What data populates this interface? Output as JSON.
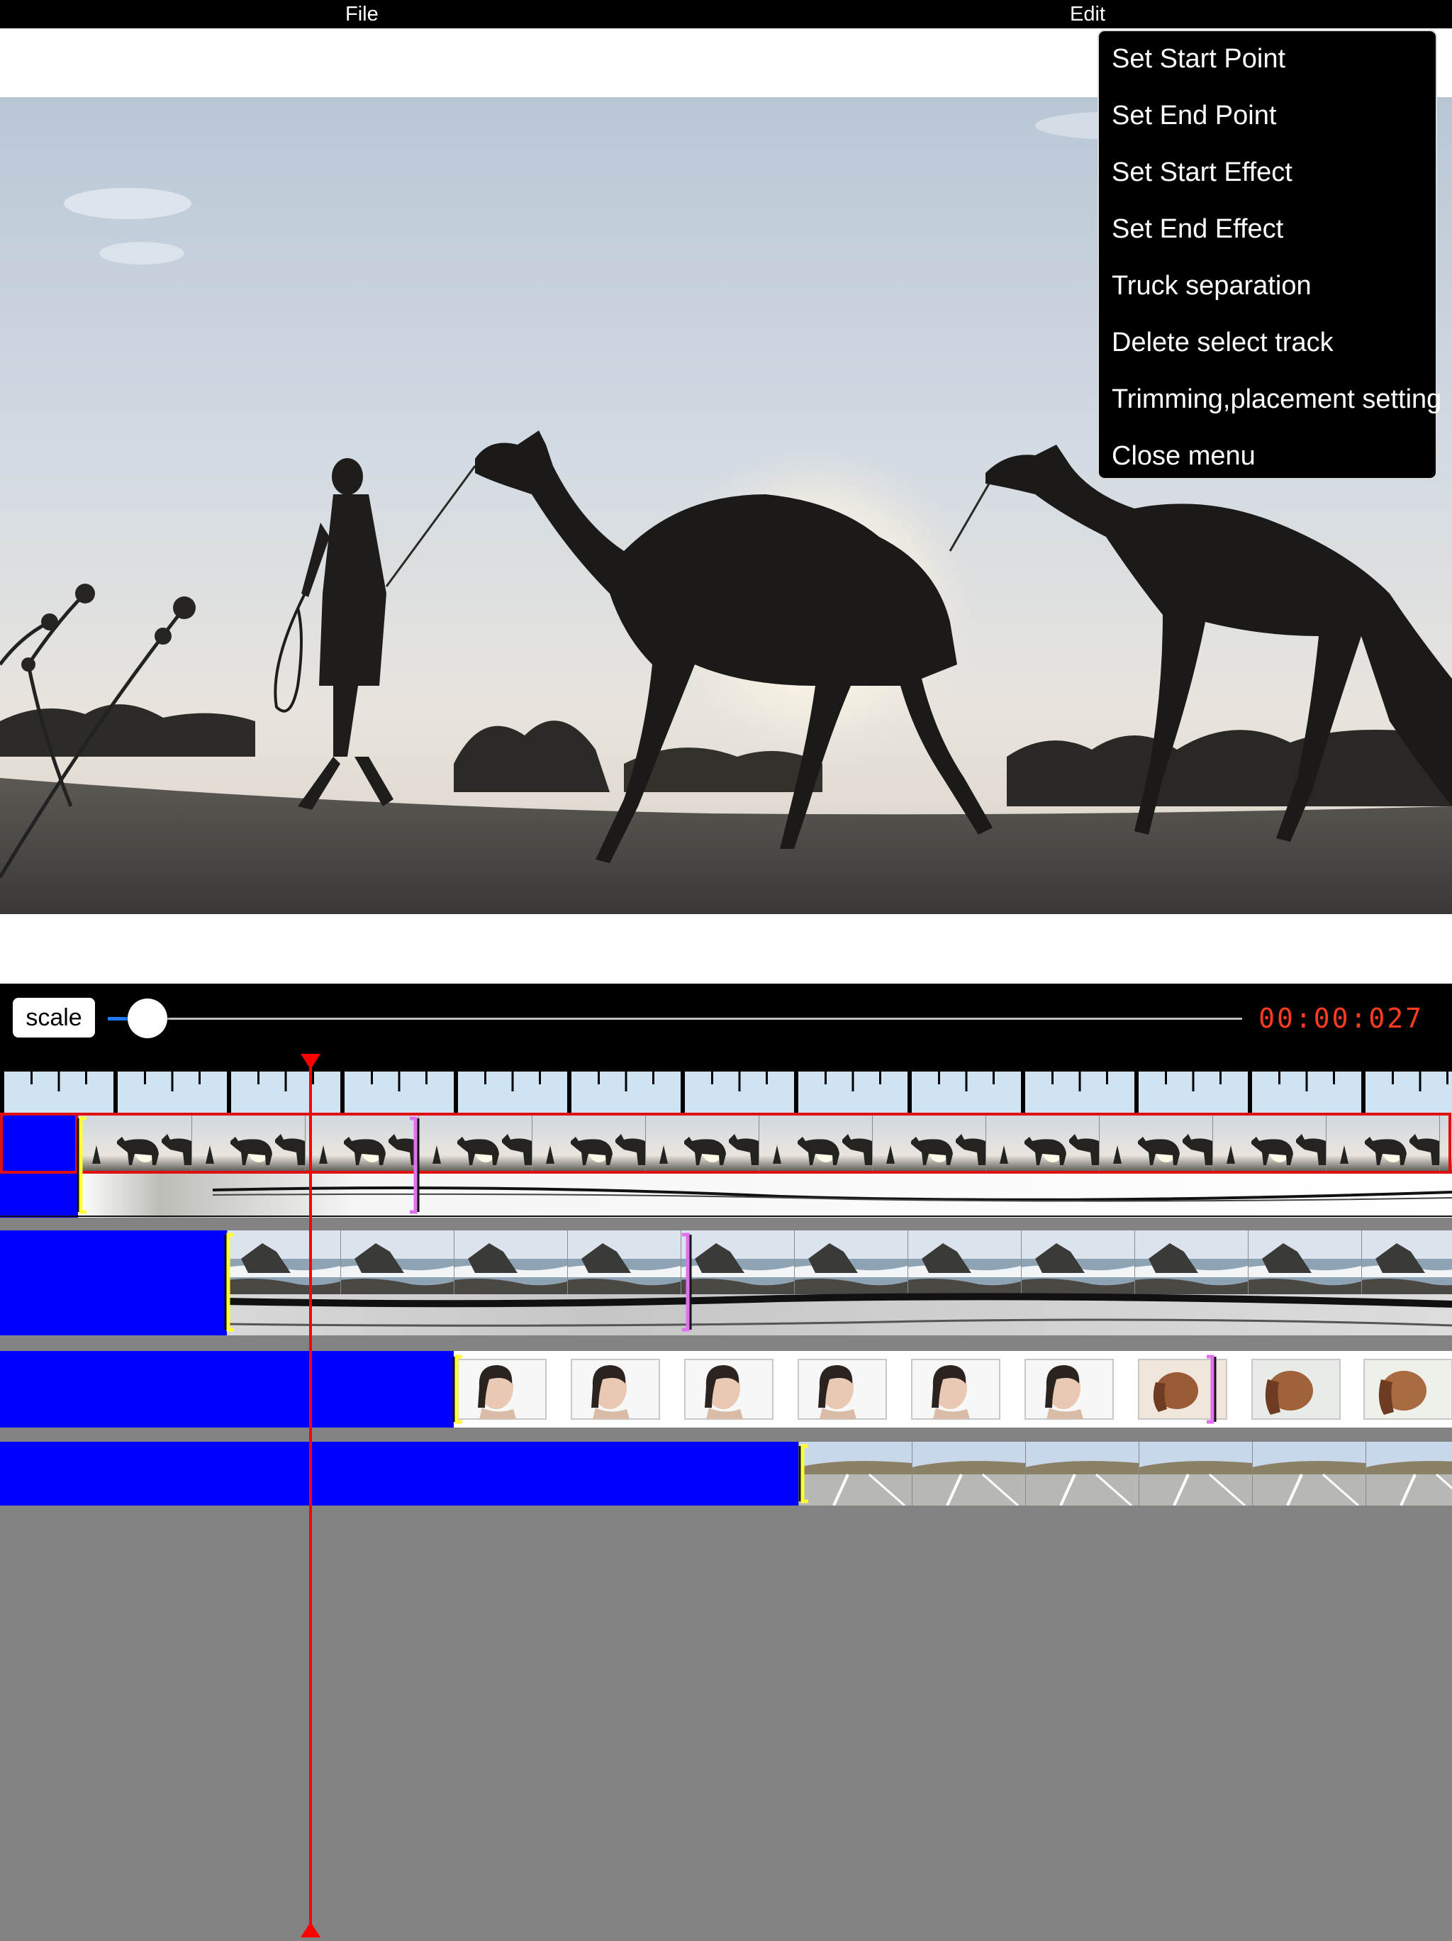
{
  "menubar": {
    "file_label": "File",
    "edit_label": "Edit"
  },
  "edit_menu": {
    "items": [
      "Set Start Point",
      "Set End Point",
      "Set Start Effect",
      "Set End Effect",
      "Truck separation",
      "Delete select track",
      "Trimming,placement setting",
      "Close menu"
    ]
  },
  "controls": {
    "scale_label": "scale",
    "timecode": "00:00:027",
    "scale_level": 0.02
  },
  "timeline": {
    "tracks": [
      {
        "name": "track-camels",
        "subject": "camels-at-sunset",
        "selected": true
      },
      {
        "name": "track-sea",
        "subject": "sea-rocks"
      },
      {
        "name": "track-portraits",
        "subject": "portrait-to-dog"
      },
      {
        "name": "track-road",
        "subject": "highway-road"
      }
    ]
  },
  "colors": {
    "menu_bg": "#000000",
    "timeline_bg": "#838383",
    "track_offset": "#0000ff",
    "timecode": "#ff3b21",
    "playhead": "#ff0000",
    "start_marker": "#ffff33",
    "end_marker": "#e070f0",
    "selection": "#e01010",
    "slider_accent": "#1f7cf5"
  }
}
